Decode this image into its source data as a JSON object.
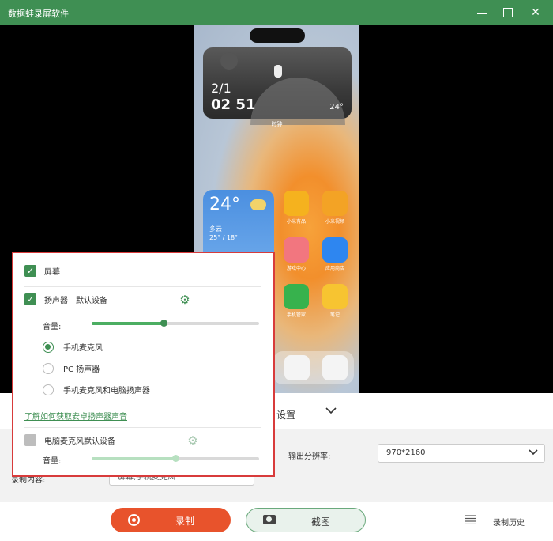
{
  "window": {
    "title": "数据蛙录屏软件"
  },
  "phone": {
    "clock_date": "2/1",
    "clock_time": "02 51",
    "clock_temp": "24°",
    "clock_widget_label": "时钟",
    "weather_temp": "24°",
    "weather_condition": "多云",
    "weather_range": "25° / 18°",
    "apps": [
      {
        "label": "小米有品",
        "color": "#f5b21e"
      },
      {
        "label": "小米视频",
        "color": "#f3a325"
      },
      {
        "label": "游戏中心",
        "color": "#f2767f"
      },
      {
        "label": "应用商店",
        "color": "#2e86f0"
      },
      {
        "label": "手机管家",
        "color": "#37b24d"
      },
      {
        "label": "笔记",
        "color": "#f7c431"
      }
    ]
  },
  "audio_panel": {
    "screen_label": "屏幕",
    "speaker_label": "扬声器",
    "speaker_device": "默认设备",
    "volume_label": "音量:",
    "speaker_volume": 0.43,
    "options": [
      "手机麦克风",
      "PC 扬声器",
      "手机麦克风和电脑扬声器"
    ],
    "selected_option": 0,
    "help_link": "了解如何获取安卓扬声器声音",
    "pc_mic_label": "电脑麦克风",
    "pc_mic_device": "默认设备",
    "mic_volume": 0.5
  },
  "settings": {
    "title": "设置",
    "output_resolution_label": "输出分辨率:",
    "output_resolution_value": "970*2160",
    "record_content_label": "录制内容:",
    "record_content_value": "屏幕,手机麦克风"
  },
  "bottom": {
    "record_label": "录制",
    "screenshot_label": "截图",
    "history_label": "录制历史"
  },
  "colors": {
    "accent": "#3f8f53",
    "record": "#e8532c",
    "highlight_border": "#d83b3b"
  }
}
